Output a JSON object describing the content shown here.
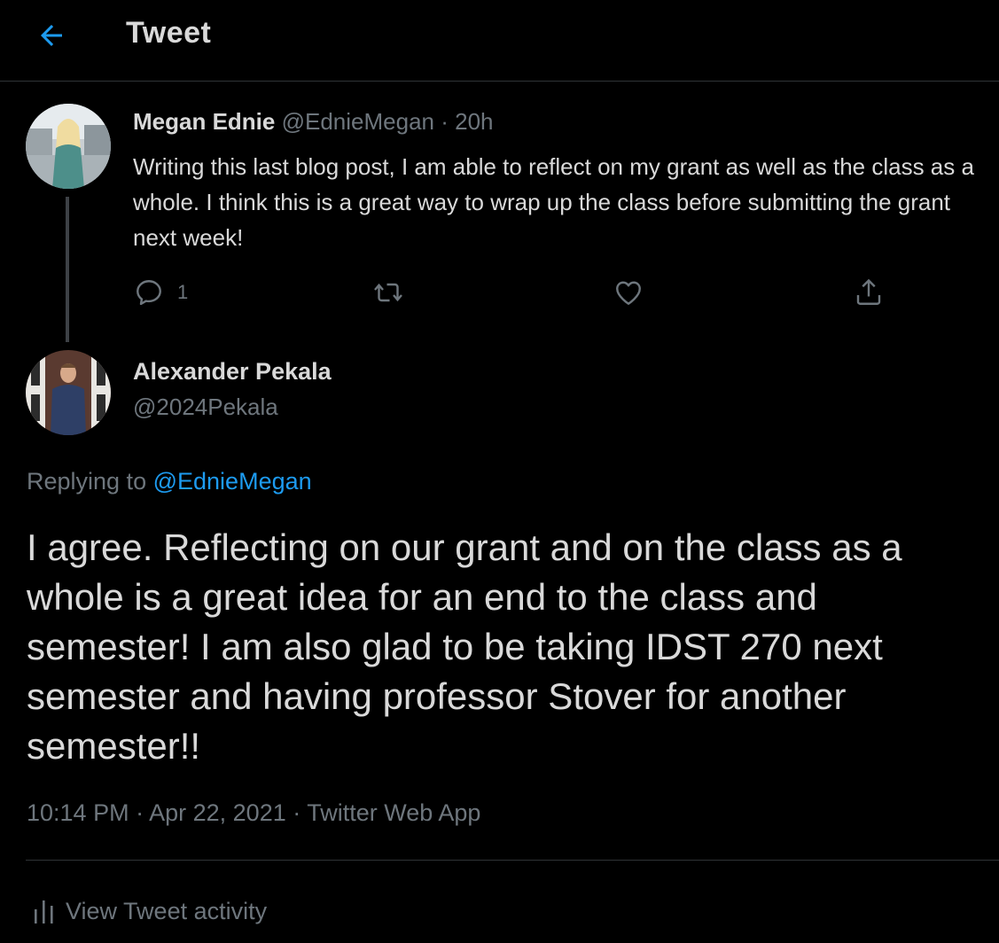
{
  "header": {
    "back_icon": "arrow-left-icon",
    "title": "Tweet"
  },
  "colors": {
    "accent": "#1d9bf0",
    "background": "#000000",
    "text": "#d9d9d9",
    "muted": "#6e767d",
    "border": "#2f3336"
  },
  "parent_tweet": {
    "author_name": "Megan Ednie",
    "author_handle": "@EdnieMegan",
    "separator": "·",
    "time_ago": "20h",
    "text": "Writing this last blog post, I am able to reflect on my grant as well as the class as a whole. I think this is a great way to wrap up the class before submitting the grant next week!",
    "actions": {
      "reply_icon": "reply-icon",
      "reply_count": "1",
      "retweet_icon": "retweet-icon",
      "like_icon": "heart-icon",
      "share_icon": "share-icon"
    }
  },
  "reply_tweet": {
    "author_name": "Alexander Pekala",
    "author_handle": "@2024Pekala",
    "replying_prefix": "Replying to",
    "replying_handle": "@EdnieMegan",
    "text": "I agree. Reflecting on our grant and on the class as a whole is a great idea for an end to the class and semester! I am also glad to be taking IDST 270 next semester and having professor Stover for another semester!!",
    "time": "10:14 PM",
    "separator_1": "·",
    "date": "Apr 22, 2021",
    "separator_2": "·",
    "source": "Twitter Web App",
    "activity_icon": "bar-chart-icon",
    "activity_label": "View Tweet activity"
  }
}
